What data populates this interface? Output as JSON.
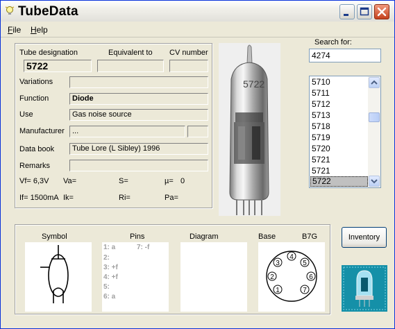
{
  "window": {
    "title": "TubeData"
  },
  "menu": [
    {
      "underline": "F",
      "rest": "ile"
    },
    {
      "underline": "H",
      "rest": "elp"
    }
  ],
  "labels": {
    "tube_designation": "Tube designation",
    "equivalent_to": "Equivalent to",
    "cv_number": "CV number",
    "variations": "Variations",
    "function": "Function",
    "use": "Use",
    "manufacturer": "Manufacturer",
    "data_book": "Data book",
    "remarks": "Remarks"
  },
  "fields": {
    "tube_designation": "5722",
    "equivalent_to": "",
    "cv_number": "",
    "variations": "",
    "function": "Diode",
    "use": "Gas noise source",
    "manufacturer": "...",
    "manufacturer_extra": "",
    "data_book": "Tube Lore (L Sibley) 1996",
    "remarks": ""
  },
  "params": {
    "vf": "Vf= 6,3V",
    "va": "Va=",
    "s": "S=",
    "mu_label": "µ=",
    "mu_value": "0",
    "if": "If= 1500mA",
    "ik": "Ik=",
    "ri": "Ri=",
    "pa": "Pa="
  },
  "search": {
    "label": "Search for:",
    "value": "4274"
  },
  "tube_list": {
    "items": [
      "5710",
      "5711",
      "5712",
      "5713",
      "5718",
      "5719",
      "5720",
      "5721",
      "5721",
      "5722"
    ],
    "selected_index": 9
  },
  "bottom": {
    "symbol_label": "Symbol",
    "pins_label": "Pins",
    "diagram_label": "Diagram",
    "base_label": "Base",
    "base_type": "B7G",
    "pins": [
      {
        "left": "1: a",
        "right": "7: -f"
      },
      {
        "left": "2:",
        "right": ""
      },
      {
        "left": "3: +f",
        "right": ""
      },
      {
        "left": "4: +f",
        "right": ""
      },
      {
        "left": "5:",
        "right": ""
      },
      {
        "left": "6: a",
        "right": ""
      }
    ],
    "base_pins": [
      "1",
      "2",
      "3",
      "4",
      "5",
      "6",
      "7"
    ]
  },
  "inventory_button": "Inventory",
  "photo_label": "5722",
  "colors": {
    "window_bg": "#ece9d8",
    "title_border": "#0831d9",
    "close_button": "#c4411d",
    "selection": "#c0c0c0",
    "logo_bg": "#0b8aa5"
  }
}
